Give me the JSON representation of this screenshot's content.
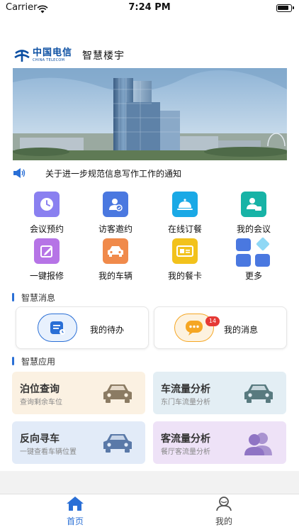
{
  "status_bar": {
    "carrier": "Carrier",
    "time": "7:24 PM"
  },
  "header": {
    "logo_cn": "中国电信",
    "logo_en": "CHINA TELECOM",
    "title": "智慧楼宇"
  },
  "notice": {
    "text": "关于进一步规范信息写作工作的通知",
    "icon": "speaker-icon"
  },
  "functions": [
    {
      "label": "会议预约",
      "icon": "clock-icon",
      "color": "#8a80f0"
    },
    {
      "label": "访客邀约",
      "icon": "visitor-icon",
      "color": "#4a78e0"
    },
    {
      "label": "在线订餐",
      "icon": "dish-cover-icon",
      "color": "#1aa9e6"
    },
    {
      "label": "我的会议",
      "icon": "meeting-person-icon",
      "color": "#17b3a6"
    },
    {
      "label": "一键报修",
      "icon": "edit-icon",
      "color": "#b674e6"
    },
    {
      "label": "我的车辆",
      "icon": "car-icon",
      "color": "#f08a4b"
    },
    {
      "label": "我的餐卡",
      "icon": "meal-card-icon",
      "color": "#f2c21c"
    },
    {
      "label": "更多",
      "icon": "more-grid-icon",
      "color": "#4a78e0"
    }
  ],
  "messages_section": {
    "title": "智慧消息",
    "todo_label": "我的待办",
    "messages_label": "我的消息",
    "messages_badge": "14"
  },
  "apps_section": {
    "title": "智慧应用",
    "apps": [
      {
        "title": "泊位查询",
        "subtitle": "查询剩余车位",
        "icon": "car-icon"
      },
      {
        "title": "车流量分析",
        "subtitle": "东门车流量分析",
        "icon": "car-icon"
      },
      {
        "title": "反向寻车",
        "subtitle": "一键查看车辆位置",
        "icon": "car-icon"
      },
      {
        "title": "客流量分析",
        "subtitle": "餐厅客流量分析",
        "icon": "people-icon"
      }
    ]
  },
  "tabbar": {
    "home": "首页",
    "mine": "我的",
    "active_color": "#2a6fd6"
  }
}
